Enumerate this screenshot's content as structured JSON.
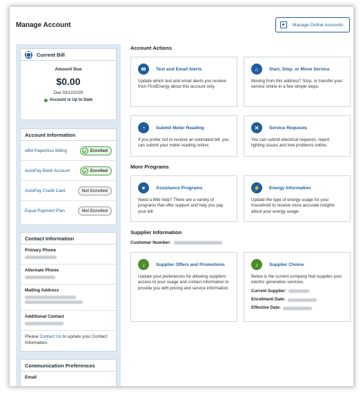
{
  "header": {
    "title": "Manage Account",
    "manage_button": "Manage Online Accounts"
  },
  "bill": {
    "title": "Current Bill",
    "amount_label": "Amount Due",
    "amount": "$0.00",
    "due": "Due 03/12/2025",
    "status": "Account is Up to Date"
  },
  "account_info": {
    "title": "Account Information",
    "rows": [
      {
        "label": "eBill Paperless Billing",
        "status": "Enrolled"
      },
      {
        "label": "AutoPay Bank Account",
        "status": "Enrolled"
      },
      {
        "label": "AutoPay Credit Card",
        "status": "Not Enrolled"
      },
      {
        "label": "Equal Payment Plan",
        "status": "Not Enrolled"
      }
    ]
  },
  "contact_info": {
    "title": "Contact Information",
    "fields": [
      "Primary Phone",
      "Alternate Phone",
      "Mailing Address",
      "Additional Contact"
    ],
    "note_prefix": "Please ",
    "note_link": "Contact Us",
    "note_suffix": " to update your Contact Information."
  },
  "comm_prefs": {
    "title": "Communication Preferences",
    "first_field": "Email"
  },
  "account_actions": {
    "title": "Account Actions",
    "tiles": [
      {
        "title": "Text and Email Alerts",
        "body": "Update which text and email alerts you receive from FirstEnergy about this account only.",
        "icon": "envelope-icon"
      },
      {
        "title": "Start, Stop, or Move Service",
        "body": "Moving from this address? Stop, or transfer your service online in a few simple steps.",
        "icon": "house-icon"
      },
      {
        "title": "Submit Meter Reading",
        "body": "If you prefer not to receive an estimated bill, you can submit your meter reading online.",
        "icon": "meter-icon"
      },
      {
        "title": "Service Requests",
        "body": "You can submit electrical requests, report lighting issues and tree problems online.",
        "icon": "tools-icon"
      }
    ]
  },
  "more_programs": {
    "title": "More Programs",
    "tiles": [
      {
        "title": "Assistance Programs",
        "body": "Need a little help? There are a variety of programs that offer support and help you pay your bill.",
        "icon": "handshake-icon"
      },
      {
        "title": "Energy Information",
        "body": "Update the type of energy usage for your household to receive more accurate insights about your energy usage.",
        "icon": "bolt-icon"
      }
    ]
  },
  "supplier": {
    "title": "Supplier Information",
    "customer_number_label": "Customer Number:",
    "offers": {
      "title": "Supplier Offers and Promotions",
      "body": "Update your preferences for allowing suppliers access to your usage and contact information to provide you with pricing and service information.",
      "icon": "bell-icon"
    },
    "choice": {
      "title": "Supplier Choice",
      "body": "Below is the current company that supplies your electric generation services.",
      "icon": "bell-icon",
      "current_label": "Current Supplier:",
      "enrollment_label": "Enrollment Date:",
      "effective_label": "Effective Date:"
    }
  }
}
